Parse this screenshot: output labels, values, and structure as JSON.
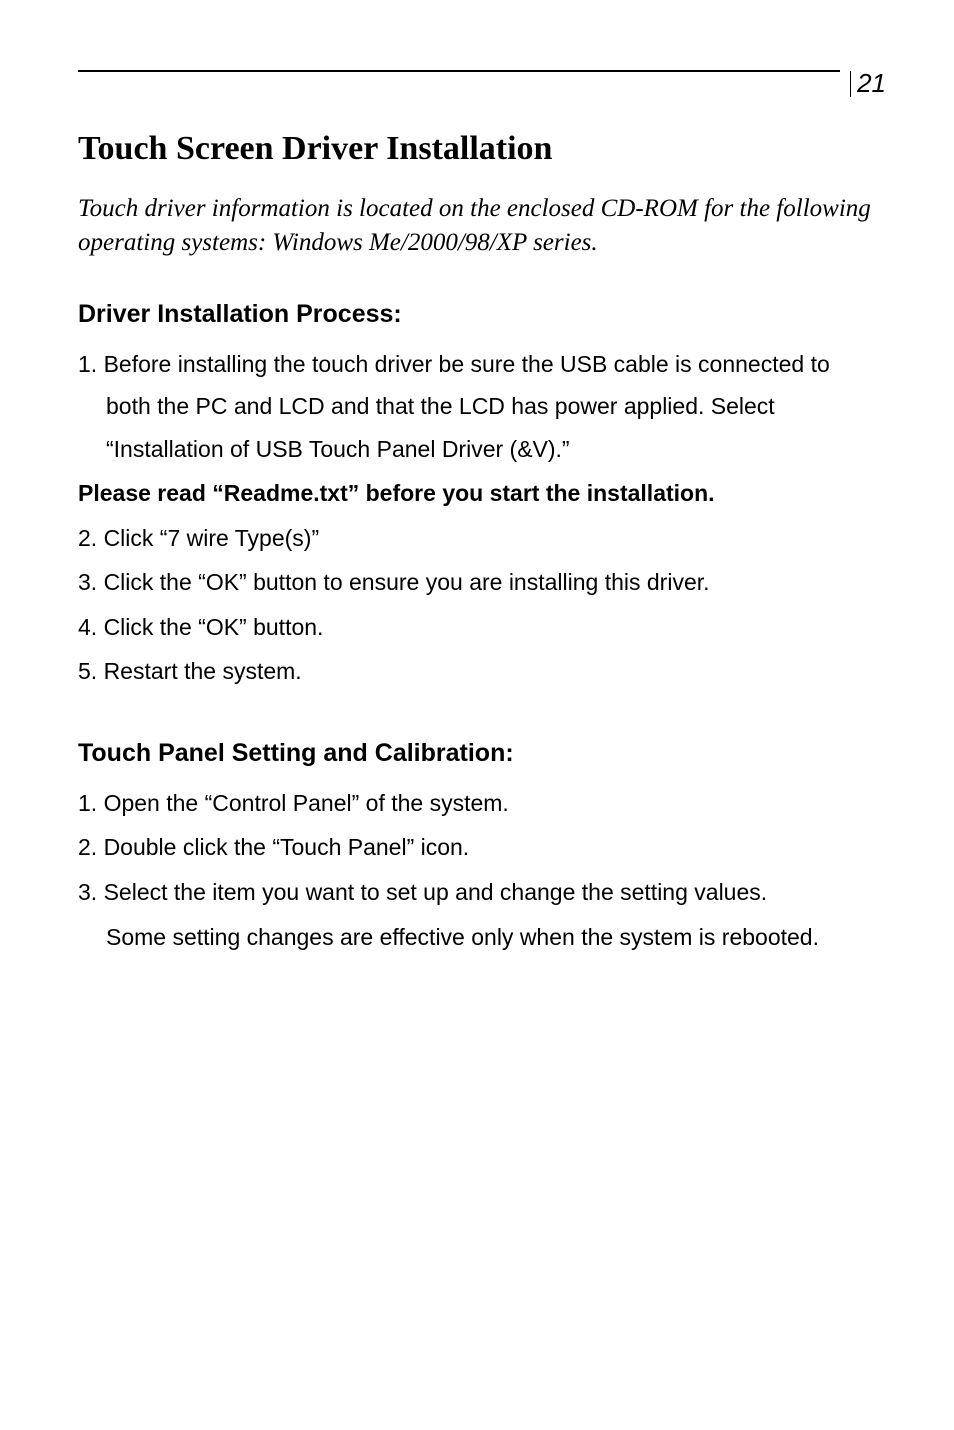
{
  "pageNumber": "21",
  "title": "Touch Screen Driver Installation",
  "intro": "Touch driver information is located on the enclosed CD-ROM for the following operating systems: Windows Me/2000/98/XP series.",
  "section1": {
    "heading": "Driver Installation Process:",
    "step1": "1. Before installing the touch driver be sure the USB cable is connected to both the PC and LCD and that the LCD has power applied. Select “Installation of USB Touch Panel Driver (&V).”",
    "note": "Please read “Readme.txt” before you start the installation.",
    "step2": "2. Click “7 wire Type(s)”",
    "step3": "3. Click the “OK” button to ensure you are installing this driver.",
    "step4": "4. Click the “OK” button.",
    "step5": "5. Restart the system."
  },
  "section2": {
    "heading": "Touch Panel Setting and Calibration:",
    "step1": "1. Open the “Control Panel” of the system.",
    "step2": "2. Double click the “Touch Panel” icon.",
    "step3a": "3. Select the item you want to set up and change the setting values.",
    "step3b": "Some setting changes are effective only when the system is rebooted."
  }
}
